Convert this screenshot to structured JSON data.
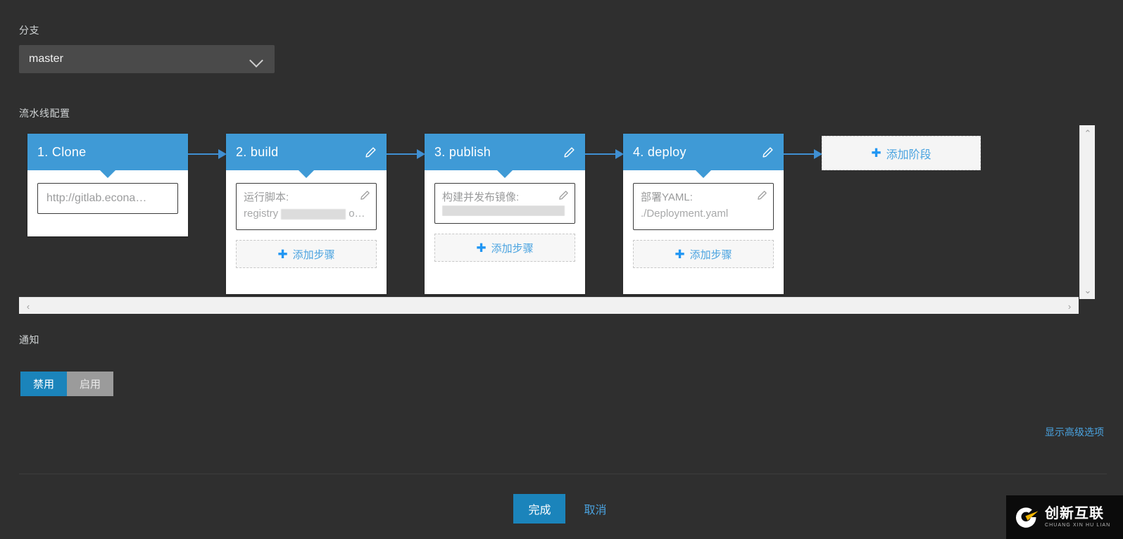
{
  "branch": {
    "label": "分支",
    "selected": "master",
    "chevron_icon": "chevron-down-icon"
  },
  "pipeline": {
    "label": "流水线配置",
    "add_stage_label": "添加阶段",
    "add_step_label": "添加步骤",
    "plus_glyph": "✚",
    "edit_icon": "pencil-icon",
    "stages": [
      {
        "index": "1.",
        "name": "Clone",
        "title": "1.  Clone",
        "editable": false,
        "has_add_step": false,
        "clone_url": "http://gitlab.econa…"
      },
      {
        "index": "2.",
        "name": "build",
        "title": "2.  build",
        "editable": true,
        "has_add_step": true,
        "step": {
          "title": "运行脚本:",
          "detail_prefix": "registry",
          "detail_redacted": true,
          "detail_suffix": "o…"
        }
      },
      {
        "index": "3.",
        "name": "publish",
        "title": "3.  publish",
        "editable": true,
        "has_add_step": true,
        "step": {
          "title": "构建并发布镜像:",
          "detail_prefix": "",
          "detail_redacted": true,
          "detail_suffix": ""
        }
      },
      {
        "index": "4.",
        "name": "deploy",
        "title": "4.  deploy",
        "editable": true,
        "has_add_step": true,
        "step": {
          "title": "部署YAML:",
          "detail_prefix": "./Deployment.yaml",
          "detail_redacted": false,
          "detail_suffix": ""
        }
      }
    ],
    "scroll": {
      "up_arrow": "⌃",
      "down_arrow": "⌄",
      "left_arrow": "‹",
      "right_arrow": "›"
    }
  },
  "notify": {
    "label": "通知",
    "options": [
      {
        "label": "禁用",
        "active": true
      },
      {
        "label": "启用",
        "active": false
      }
    ]
  },
  "advanced_link": "显示高级选项",
  "footer": {
    "confirm": "完成",
    "cancel": "取消"
  },
  "watermark": {
    "cn": "创新互联",
    "en": "CHUANG XIN HU LIAN"
  },
  "colors": {
    "background": "#2f2f2f",
    "stage_header": "#3f9ad6",
    "accent_blue": "#4aa3e0",
    "primary_button": "#1b84bb",
    "connector": "#3f8fd2",
    "segment_idle": "#9b9b9b"
  }
}
